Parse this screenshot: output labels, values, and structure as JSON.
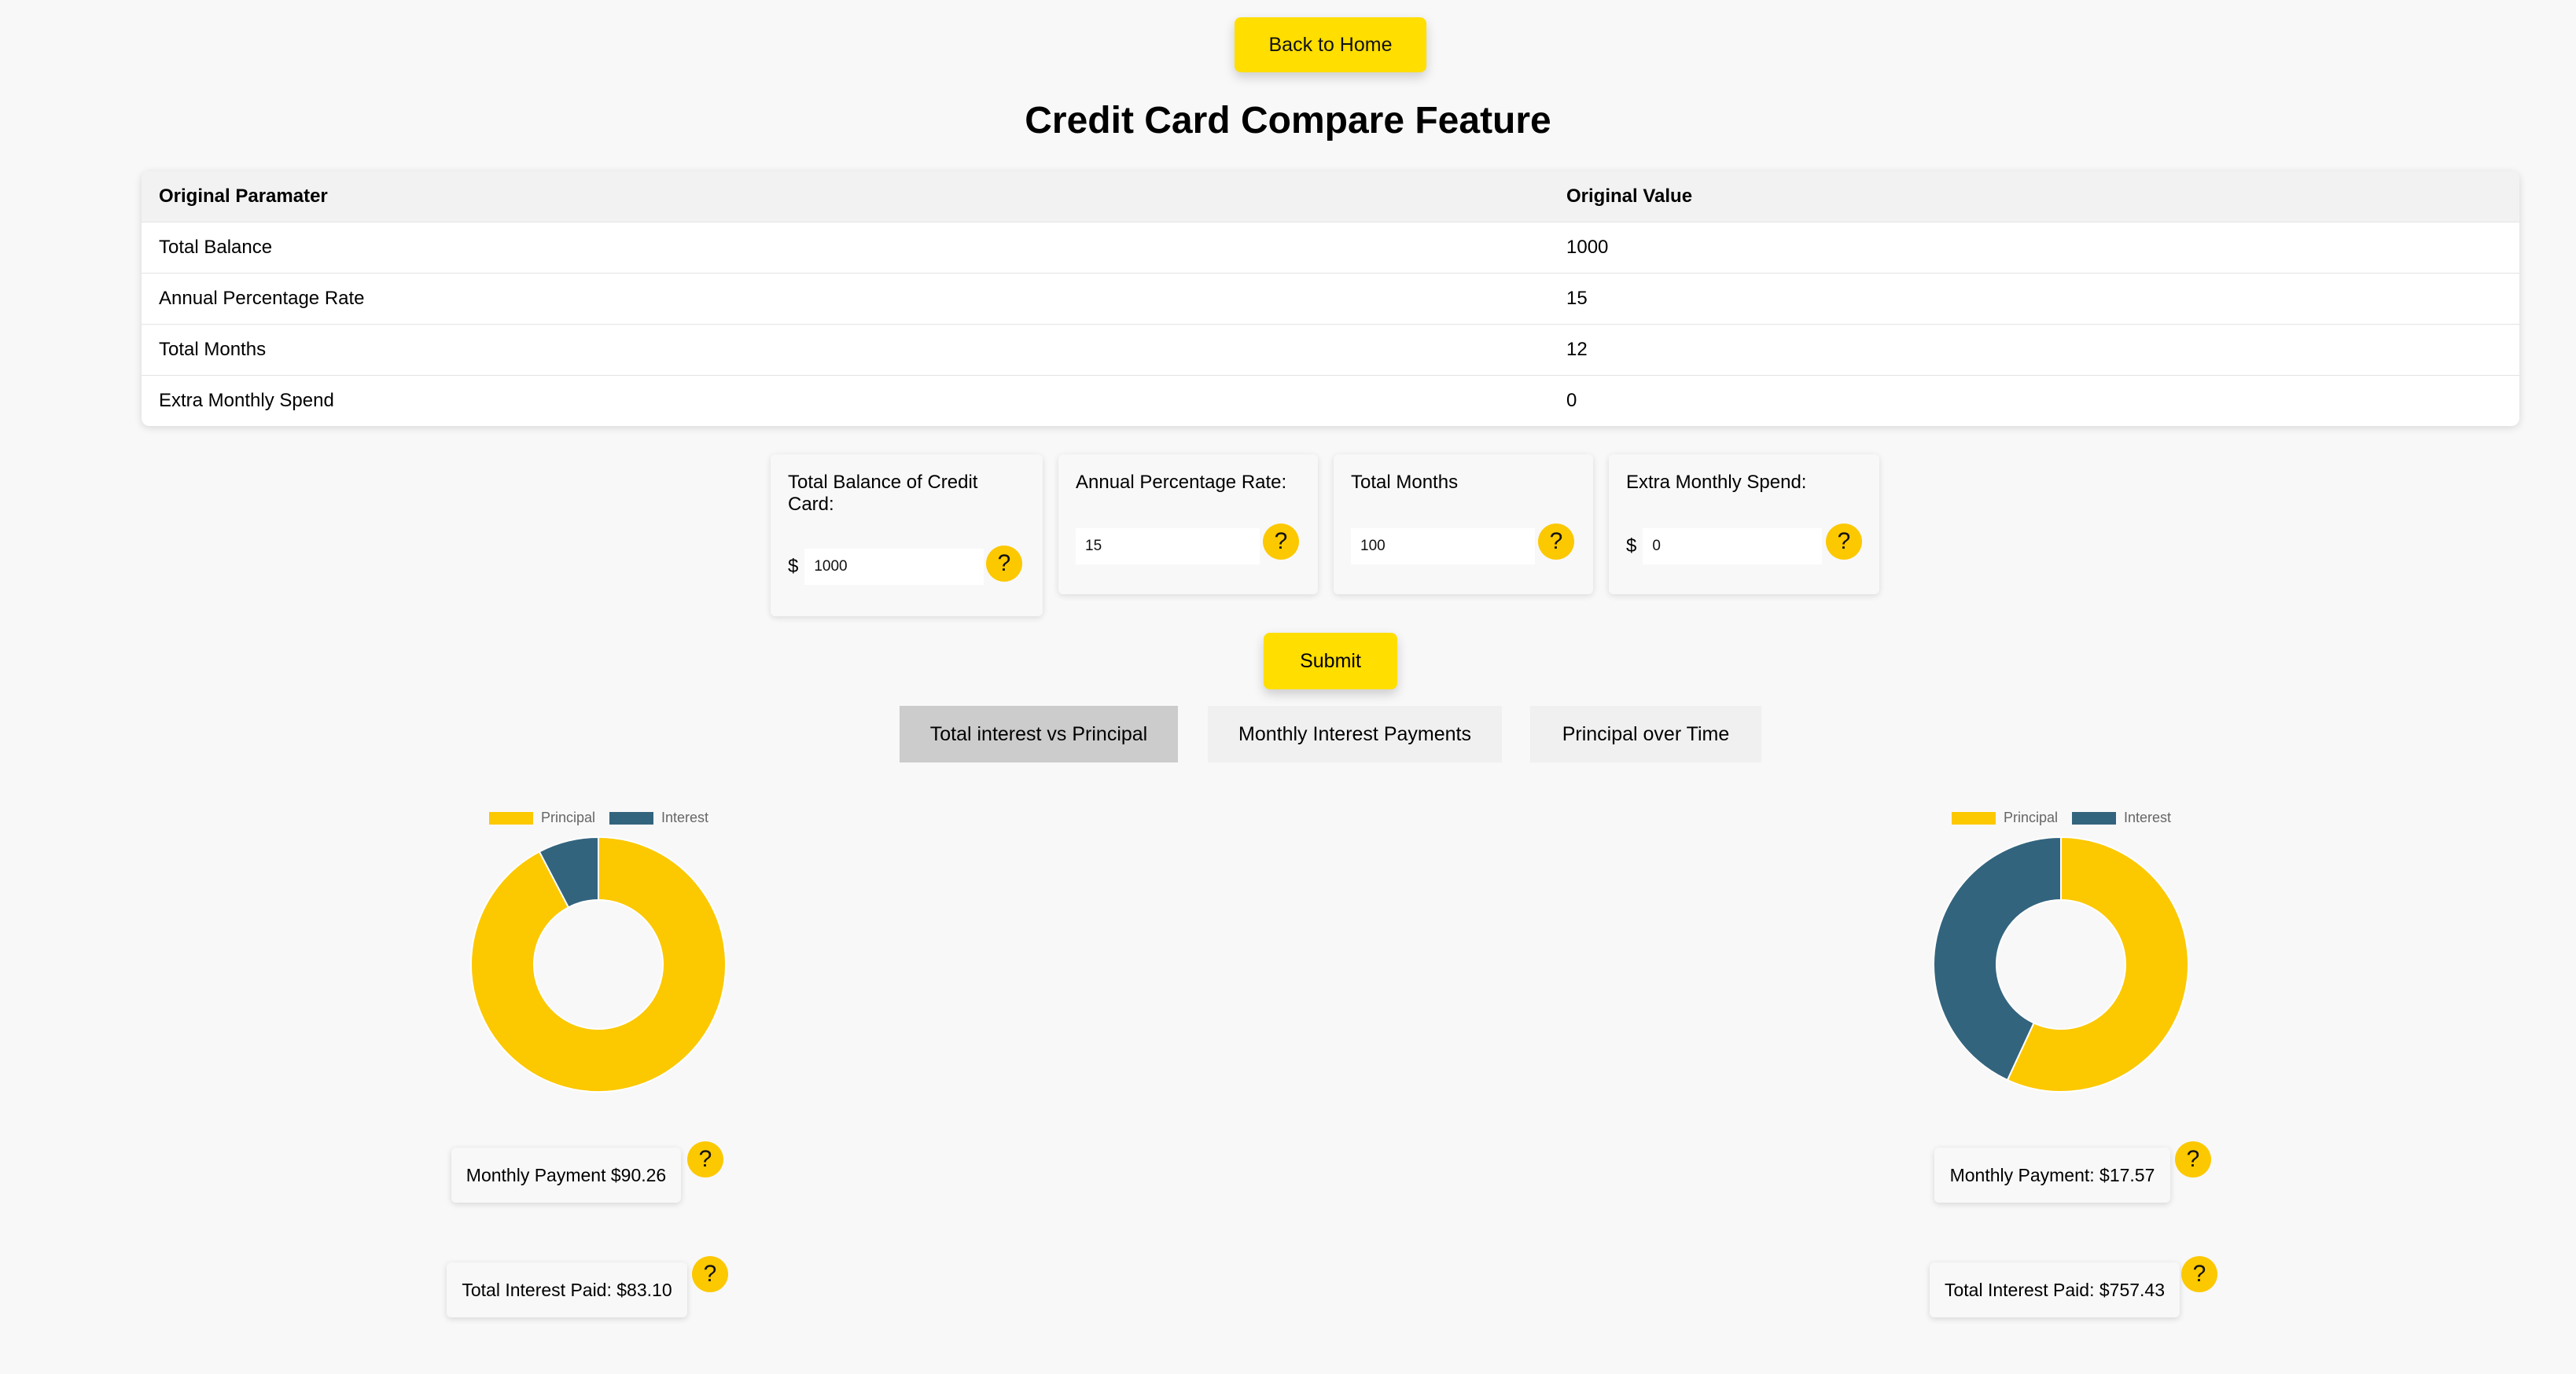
{
  "header": {
    "back_label": "Back to Home",
    "title": "Credit Card Compare Feature"
  },
  "params_table": {
    "headers": [
      "Original Paramater",
      "Original Value"
    ],
    "rows": [
      [
        "Total Balance",
        "1000"
      ],
      [
        "Annual Percentage Rate",
        "15"
      ],
      [
        "Total Months",
        "12"
      ],
      [
        "Extra Monthly Spend",
        "0"
      ]
    ]
  },
  "inputs": {
    "balance": {
      "label": "Total Balance of Credit Card:",
      "prefix": "$",
      "value": "1000"
    },
    "apr": {
      "label": "Annual Percentage Rate:",
      "value": "15"
    },
    "months": {
      "label": "Total Months",
      "value": "100"
    },
    "extra": {
      "label": "Extra Monthly Spend:",
      "prefix": "$",
      "value": "0"
    },
    "help_symbol": "?"
  },
  "submit_label": "Submit",
  "tabs": [
    {
      "label": "Total interest vs Principal",
      "active": true
    },
    {
      "label": "Monthly Interest Payments",
      "active": false
    },
    {
      "label": "Principal over Time",
      "active": false
    }
  ],
  "colors": {
    "principal": "#fcc800",
    "interest": "#33647e",
    "accent": "#ffde00"
  },
  "chart_data": [
    {
      "type": "pie",
      "variant": "doughnut",
      "legend": [
        "Principal",
        "Interest"
      ],
      "legend_position": "top",
      "categories": [
        "Principal",
        "Interest"
      ],
      "values": [
        1000,
        83.1
      ]
    },
    {
      "type": "pie",
      "variant": "doughnut",
      "legend": [
        "Principal",
        "Interest"
      ],
      "legend_position": "top",
      "categories": [
        "Principal",
        "Interest"
      ],
      "values": [
        1000,
        757.43
      ]
    }
  ],
  "results": {
    "left": {
      "monthly_payment": "Monthly Payment $90.26",
      "total_interest": "Total Interest Paid: $83.10"
    },
    "right": {
      "monthly_payment": "Monthly Payment: $17.57",
      "total_interest": "Total Interest Paid: $757.43"
    }
  }
}
